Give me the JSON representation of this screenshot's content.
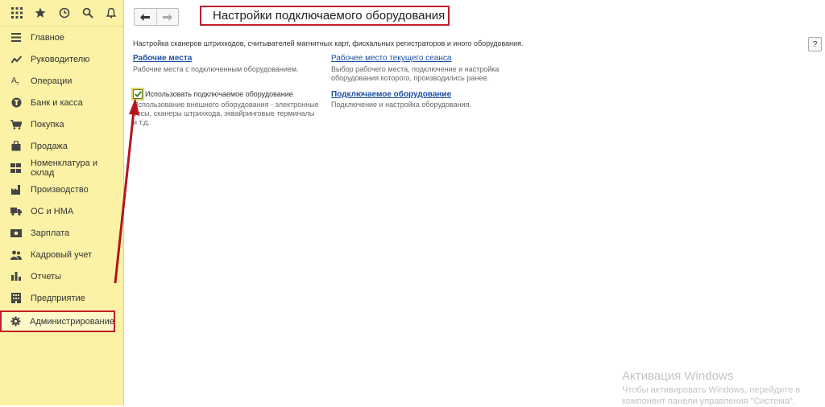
{
  "sidebar": {
    "items": [
      {
        "label": "Главное",
        "icon": "menu-lines-icon"
      },
      {
        "label": "Руководителю",
        "icon": "trend-line-icon"
      },
      {
        "label": "Операции",
        "icon": "operations-icon"
      },
      {
        "label": "Банк и касса",
        "icon": "coin-icon"
      },
      {
        "label": "Покупка",
        "icon": "cart-icon"
      },
      {
        "label": "Продажа",
        "icon": "bag-icon"
      },
      {
        "label": "Номенклатура и склад",
        "icon": "boxes-icon"
      },
      {
        "label": "Производство",
        "icon": "factory-icon"
      },
      {
        "label": "ОС и НМА",
        "icon": "truck-icon"
      },
      {
        "label": "Зарплата",
        "icon": "money-icon"
      },
      {
        "label": "Кадровый учет",
        "icon": "people-icon"
      },
      {
        "label": "Отчеты",
        "icon": "bar-chart-icon"
      },
      {
        "label": "Предприятие",
        "icon": "building-icon"
      },
      {
        "label": "Администрирование",
        "icon": "gear-icon"
      }
    ]
  },
  "header": {
    "title": "Настройки подключаемого оборудования",
    "help": "?"
  },
  "main": {
    "intro": "Настройка сканеров штрихкодов, считывателей магнитных карт, фискальных регистраторов и иного оборудования.",
    "workplaces": {
      "link": "Рабочие места",
      "desc": "Рабочие места с подключенным оборудованием."
    },
    "current_session": {
      "link": "Рабочее место текущего сеанса",
      "desc": "Выбор рабочего места, подключение и настройка оборудования которого, производились ранее."
    },
    "use_equipment": {
      "label": "Использовать подключаемое оборудование",
      "checked": true,
      "desc": "Использование внешнего оборудования - электронные весы, сканеры штрихкода, эквайринговые терминалы и т.д."
    },
    "connected": {
      "link": "Подключаемое оборудование",
      "desc": "Подключение и настройка оборудования."
    }
  },
  "watermark": {
    "title": "Активация Windows",
    "text": "Чтобы активировать Windows, перейдите в компонент панели управления \"Система\"."
  },
  "colors": {
    "sidebar_bg": "#fbf2a6",
    "highlight": "#c21e2a",
    "link": "#1b4fa0"
  }
}
